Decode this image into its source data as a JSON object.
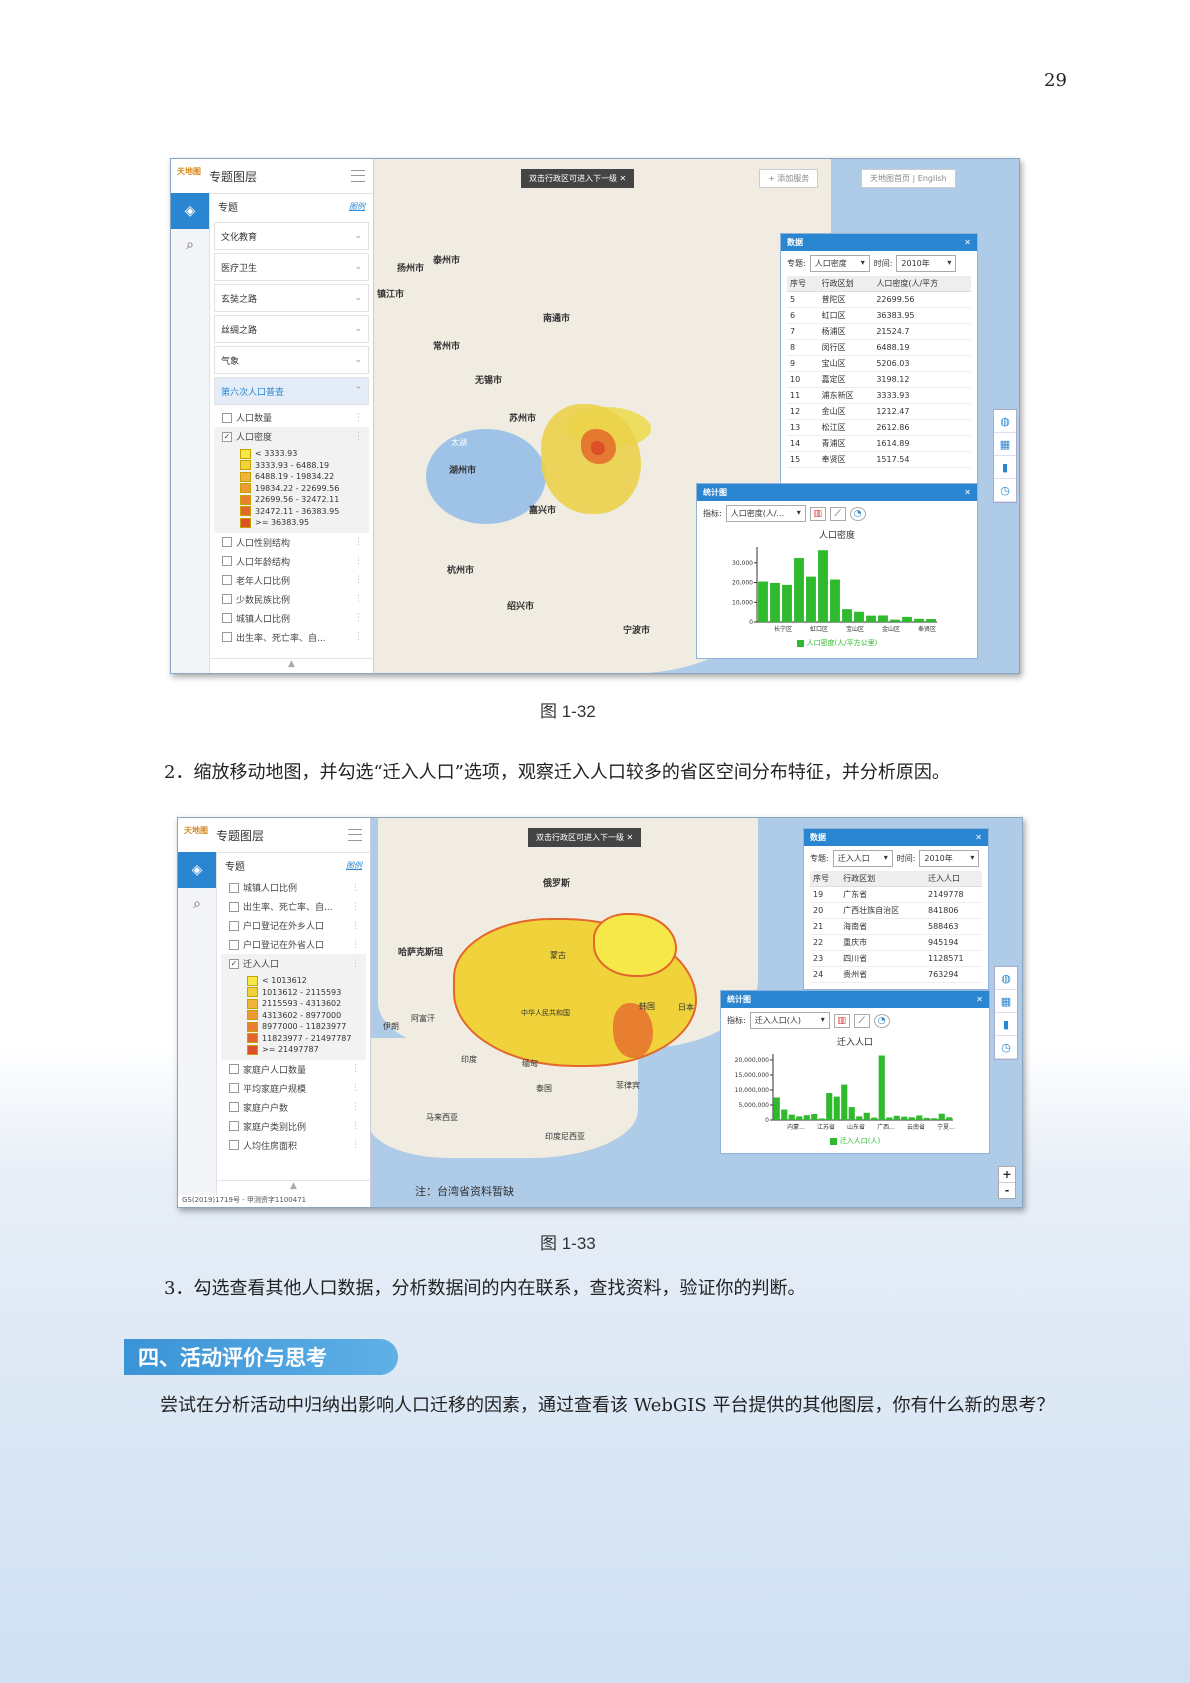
{
  "page_number": "29",
  "fig1": {
    "caption": "图 1-32",
    "sidebar": {
      "title": "专题图层",
      "section": "专题",
      "legend_link": "图例",
      "categories": [
        "文化教育",
        "医疗卫生",
        "玄奘之路",
        "丝绸之路",
        "气象",
        "第六次人口普查"
      ],
      "layers_before": [
        "人口数量"
      ],
      "active_layer": "人口密度",
      "legend": [
        "< 3333.93",
        "3333.93 - 6488.19",
        "6488.19 - 19834.22",
        "19834.22 - 22699.56",
        "22699.56 - 32472.11",
        "32472.11 - 36383.95",
        ">= 36383.95"
      ],
      "layers_after": [
        "人口性别结构",
        "人口年龄结构",
        "老年人口比例",
        "少数民族比例",
        "城镇人口比例",
        "出生率、死亡率、自..."
      ]
    },
    "tip": "双击行政区可进入下一级",
    "add_service": "+ 添加服务",
    "top_links": "天地图首页  |  English",
    "data_panel": {
      "title": "数据",
      "topic_label": "专题:",
      "topic": "人口密度",
      "time_label": "时间:",
      "time": "2010年",
      "headers": [
        "序号",
        "行政区划",
        "人口密度(人/平方"
      ],
      "rows": [
        [
          "5",
          "普陀区",
          "22699.56"
        ],
        [
          "6",
          "虹口区",
          "36383.95"
        ],
        [
          "7",
          "杨浦区",
          "21524.7"
        ],
        [
          "8",
          "闵行区",
          "6488.19"
        ],
        [
          "9",
          "宝山区",
          "5206.03"
        ],
        [
          "10",
          "嘉定区",
          "3198.12"
        ],
        [
          "11",
          "浦东新区",
          "3333.93"
        ],
        [
          "12",
          "金山区",
          "1212.47"
        ],
        [
          "13",
          "松江区",
          "2612.86"
        ],
        [
          "14",
          "青浦区",
          "1614.89"
        ],
        [
          "15",
          "奉贤区",
          "1517.54"
        ]
      ]
    },
    "chart_panel": {
      "title": "统计图",
      "indicator_label": "指标:",
      "indicator": "人口密度(人/...",
      "chart_title": "人口密度",
      "legend": "人口密度(人/平方公里)"
    },
    "map_labels": [
      "扬州市",
      "泰州市",
      "南通市",
      "常州市",
      "无锡市",
      "苏州市",
      "湖州市",
      "嘉兴市",
      "杭州市",
      "绍兴市",
      "宁波市",
      "镇江市",
      "太湖"
    ]
  },
  "fig1_chart_data": {
    "type": "bar",
    "title": "人口密度",
    "ylabel": "",
    "series_name": "人口密度(人/平方公里)",
    "yticks": [
      "0",
      "10,000",
      "20,000",
      "30,000"
    ],
    "xticks": [
      "长宁区",
      "虹口区",
      "宝山区",
      "金山区",
      "奉贤区"
    ],
    "ylim": [
      0,
      38000
    ],
    "values": [
      20500,
      19800,
      18800,
      32400,
      23000,
      36383,
      21500,
      6500,
      5200,
      3200,
      3300,
      1200,
      2600,
      1600,
      1500
    ]
  },
  "instruction_2": "2．缩放移动地图，并勾选“迁入人口”选项，观察迁入人口较多的省区空间分布特征，并分析原因。",
  "fig2": {
    "caption": "图 1-33",
    "sidebar": {
      "title": "专题图层",
      "section": "专题",
      "legend_link": "图例",
      "layers_before": [
        "城镇人口比例",
        "出生率、死亡率、自...",
        "户口登记在外乡人口",
        "户口登记在外省人口"
      ],
      "active_layer": "迁入人口",
      "legend": [
        "< 1013612",
        "1013612 - 2115593",
        "2115593 - 4313602",
        "4313602 - 8977000",
        "8977000 - 11823977",
        "11823977 - 21497787",
        ">= 21497787"
      ],
      "layers_after": [
        "家庭户人口数量",
        "平均家庭户规模",
        "家庭户户数",
        "家庭户类别比例",
        "人均住房面积"
      ]
    },
    "tip": "双击行政区可进入下一级",
    "data_panel": {
      "title": "数据",
      "topic_label": "专题:",
      "topic": "迁入人口",
      "time_label": "时间:",
      "time": "2010年",
      "headers": [
        "序号",
        "行政区划",
        "迁入人口"
      ],
      "rows": [
        [
          "19",
          "广东省",
          "2149778"
        ],
        [
          "20",
          "广西壮族自治区",
          "841806"
        ],
        [
          "21",
          "海南省",
          "588463"
        ],
        [
          "22",
          "重庆市",
          "945194"
        ],
        [
          "23",
          "四川省",
          "1128571"
        ],
        [
          "24",
          "贵州省",
          "763294"
        ]
      ]
    },
    "chart_panel": {
      "title": "统计图",
      "indicator_label": "指标:",
      "indicator": "迁入人口(人)",
      "chart_title": "迁入人口",
      "legend": "迁入人口(人)"
    },
    "map_labels": [
      "俄罗斯",
      "哈萨克斯坦",
      "蒙古",
      "中华人民共和国",
      "韩国",
      "日本",
      "伊朗",
      "阿富汗",
      "印度",
      "缅甸",
      "泰国",
      "菲律宾",
      "马来西亚",
      "印度尼西亚"
    ],
    "note": "注：台湾省资料暂缺",
    "copyright": "GS(2019)1719号 - 甲测资字1100471",
    "zoom_in": "+",
    "zoom_out": "-"
  },
  "fig2_chart_data": {
    "type": "bar",
    "title": "迁入人口",
    "series_name": "迁入人口(人)",
    "yticks": [
      "0",
      "5,000,000",
      "10,000,000",
      "15,000,000",
      "20,000,000"
    ],
    "xticks": [
      "内蒙...",
      "江苏省",
      "山东省",
      "广西...",
      "云南省",
      "宁夏..."
    ],
    "ylim": [
      0,
      22000000
    ],
    "values": [
      7500000,
      3500000,
      1800000,
      1200000,
      1600000,
      2000000,
      500000,
      9000000,
      7800000,
      11800000,
      4300000,
      1200000,
      2400000,
      800000,
      21497787,
      840000,
      1400000,
      1100000,
      900000,
      1500000,
      700000,
      600000,
      2100000,
      900000
    ]
  },
  "instruction_3": "3．勾选查看其他人口数据，分析数据间的内在联系，查找资料，验证你的判断。",
  "section_title": "四、活动评价与思考",
  "closing_paragraph": "尝试在分析活动中归纳出影响人口迁移的因素，通过查看该 WebGIS 平台提供的其他图层，你有什么新的思考？",
  "colors": {
    "accent": "#2a86d1",
    "bar": "#2fb92c",
    "legend_scale": [
      "#f7e84a",
      "#f0d23a",
      "#f0b43a",
      "#ec9a34",
      "#e87e30",
      "#e3662c",
      "#dd4f28"
    ]
  }
}
